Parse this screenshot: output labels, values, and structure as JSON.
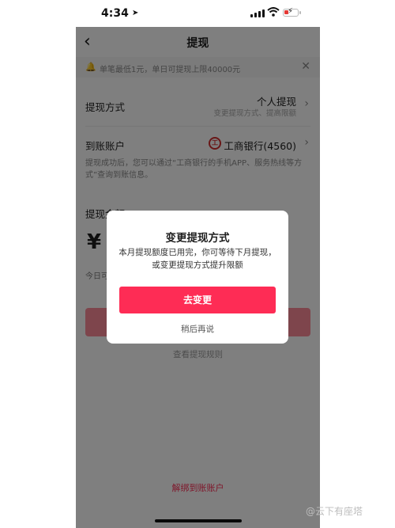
{
  "status_bar": {
    "time": "4:34",
    "location_icon": "location-arrow-icon"
  },
  "nav": {
    "back_icon": "chevron-left-icon",
    "title": "提现"
  },
  "notice": {
    "text": "单笔最低1元，单日可提现上限40000元",
    "close_icon": "close-icon"
  },
  "method": {
    "label": "提现方式",
    "value": "个人提现",
    "sub": "变更提现方式、提高限额"
  },
  "account": {
    "label": "到账账户",
    "bank": "工商银行(4560)",
    "bank_icon_text": "工"
  },
  "info": "提现成功后，您可以通过“工商银行的手机APP、服务热线等方式”查询到账信息。",
  "amount": {
    "label": "提现金额",
    "currency": "¥",
    "today": "今日可"
  },
  "rules_link": "查看提现规则",
  "unbind_link": "解绑到账账户",
  "dialog": {
    "title": "变更提现方式",
    "message": "本月提现额度已用完，你可等待下月提现，或变更提现方式提升限额",
    "primary": "去变更",
    "secondary": "稍后再说"
  },
  "watermark": "@云下有座塔",
  "colors": {
    "accent": "#fe2c55",
    "bank_red": "#d32f2f",
    "overlay": "rgba(0,0,0,0.5)"
  }
}
